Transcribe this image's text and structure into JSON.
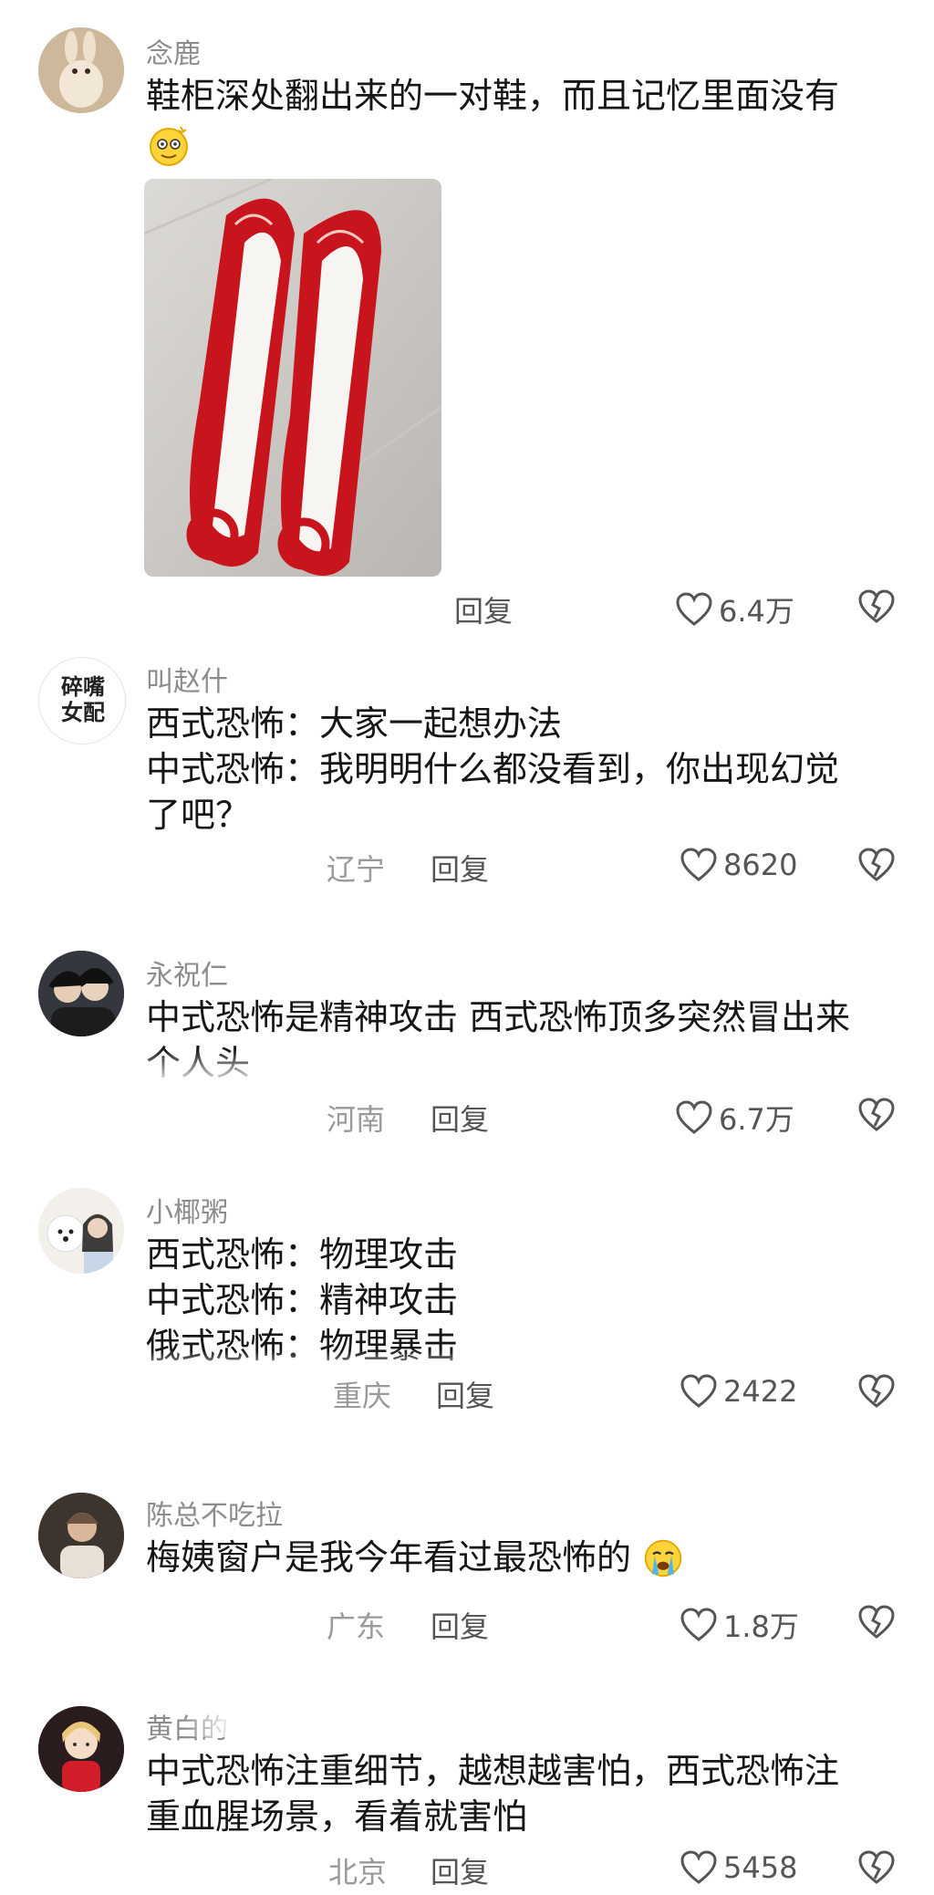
{
  "comments": [
    {
      "username": "念鹿",
      "lines": [
        "鞋柜深处翻出来的一对鞋，而且记忆里面没有"
      ],
      "emoji": "dizzy-face-emoji",
      "location": "",
      "reply_label": "回复",
      "likes": "6.4万",
      "has_image": true,
      "image_icon": "red-embroidered-shoes-photo"
    },
    {
      "username": "叫赵什",
      "avatar_text": "碎嘴女配",
      "lines": [
        "西式恐怖：大家一起想办法",
        "中式恐怖：我明明什么都没看到，你出现幻觉",
        "了吧？"
      ],
      "location": "辽宁",
      "reply_label": "回复",
      "likes": "8620"
    },
    {
      "username": "永祝仁",
      "lines": [
        "中式恐怖是精神攻击 西式恐怖顶多突然冒出来",
        "个人头"
      ],
      "location": "河南",
      "reply_label": "回复",
      "likes": "6.7万"
    },
    {
      "username": "小椰粥",
      "lines": [
        "西式恐怖：物理攻击",
        "中式恐怖：精神攻击",
        "俄式恐怖：物理暴击"
      ],
      "location": "重庆",
      "reply_label": "回复",
      "likes": "2422"
    },
    {
      "username": "陈总不吃拉",
      "lines": [
        "梅姨窗户是我今年看过最恐怖的"
      ],
      "emoji": "crying-face-emoji",
      "location": "广东",
      "reply_label": "回复",
      "likes": "1.8万"
    },
    {
      "username": "黄白的",
      "lines": [
        "中式恐怖注重细节，越想越害怕，西式恐怖注",
        "重血腥场景，看着就害怕"
      ],
      "location": "北京",
      "reply_label": "回复",
      "likes": "5458"
    }
  ],
  "icons": {
    "like": "heart-outline-icon",
    "dislike": "broken-heart-icon"
  },
  "colors": {
    "text": "#161616",
    "username": "#8c8c8c",
    "meta": "#555555",
    "shoe_red": "#c8141c"
  }
}
